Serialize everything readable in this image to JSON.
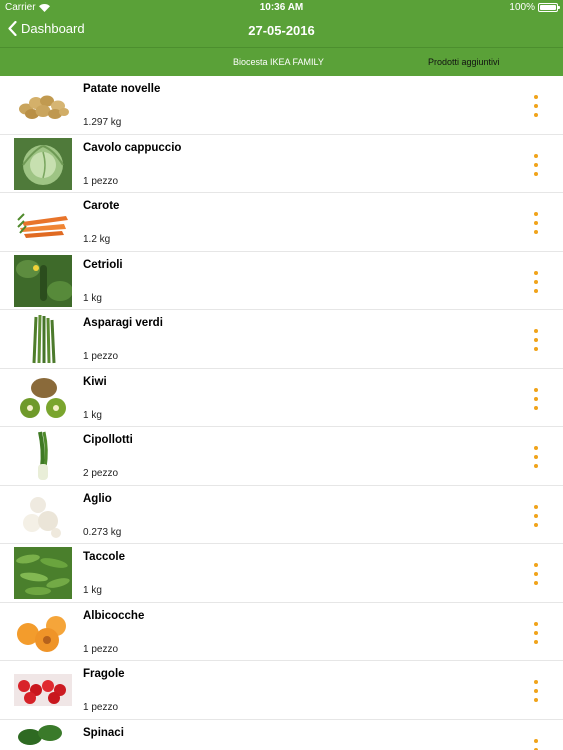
{
  "status_bar": {
    "carrier": "Carrier",
    "time": "10:36 AM",
    "battery": "100%"
  },
  "nav": {
    "back_label": "Dashboard",
    "title": "27-05-2016"
  },
  "tabs": [
    {
      "label": "Biocesta IKEA FAMILY"
    },
    {
      "label": "Prodotti aggiuntivi"
    }
  ],
  "accent_color": "#5aa138",
  "menu_dot_color": "#f0a31a",
  "items": [
    {
      "name": "Patate novelle",
      "quantity": "1.297 kg",
      "icon": "potatoes-image"
    },
    {
      "name": "Cavolo cappuccio",
      "quantity": "1 pezzo",
      "icon": "cabbage-image"
    },
    {
      "name": "Carote",
      "quantity": "1.2 kg",
      "icon": "carrots-image"
    },
    {
      "name": "Cetrioli",
      "quantity": "1 kg",
      "icon": "cucumbers-image"
    },
    {
      "name": "Asparagi verdi",
      "quantity": "1 pezzo",
      "icon": "asparagus-image"
    },
    {
      "name": "Kiwi",
      "quantity": "1 kg",
      "icon": "kiwi-image"
    },
    {
      "name": "Cipollotti",
      "quantity": "2 pezzo",
      "icon": "spring-onions-image"
    },
    {
      "name": "Aglio",
      "quantity": "0.273 kg",
      "icon": "garlic-image"
    },
    {
      "name": "Taccole",
      "quantity": "1 kg",
      "icon": "snow-peas-image"
    },
    {
      "name": "Albicocche",
      "quantity": "1 pezzo",
      "icon": "apricots-image"
    },
    {
      "name": "Fragole",
      "quantity": "1 pezzo",
      "icon": "strawberries-image"
    },
    {
      "name": "Spinaci",
      "quantity": "",
      "icon": "spinach-image"
    }
  ]
}
